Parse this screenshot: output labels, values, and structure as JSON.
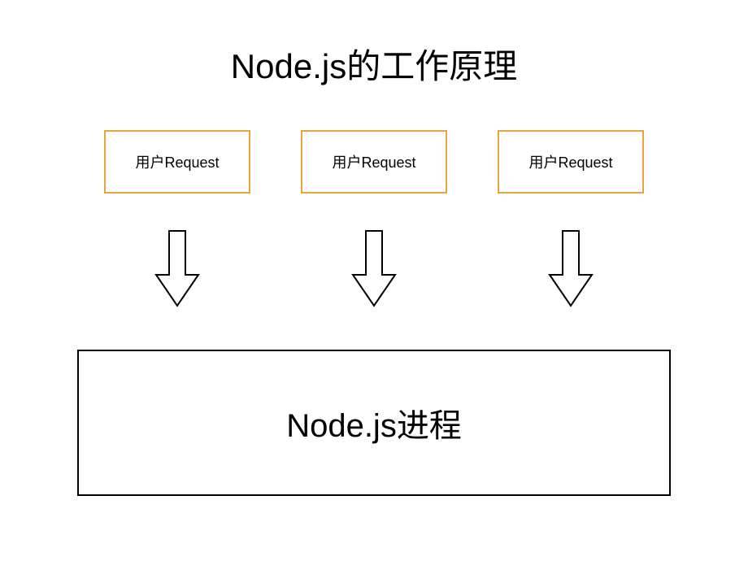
{
  "title": "Node.js的工作原理",
  "requests": [
    {
      "label": "用户Request"
    },
    {
      "label": "用户Request"
    },
    {
      "label": "用户Request"
    }
  ],
  "process": {
    "label": "Node.js进程"
  },
  "colors": {
    "requestBorder": "#E8A33D",
    "processBorder": "#000000",
    "arrowStroke": "#000000"
  }
}
